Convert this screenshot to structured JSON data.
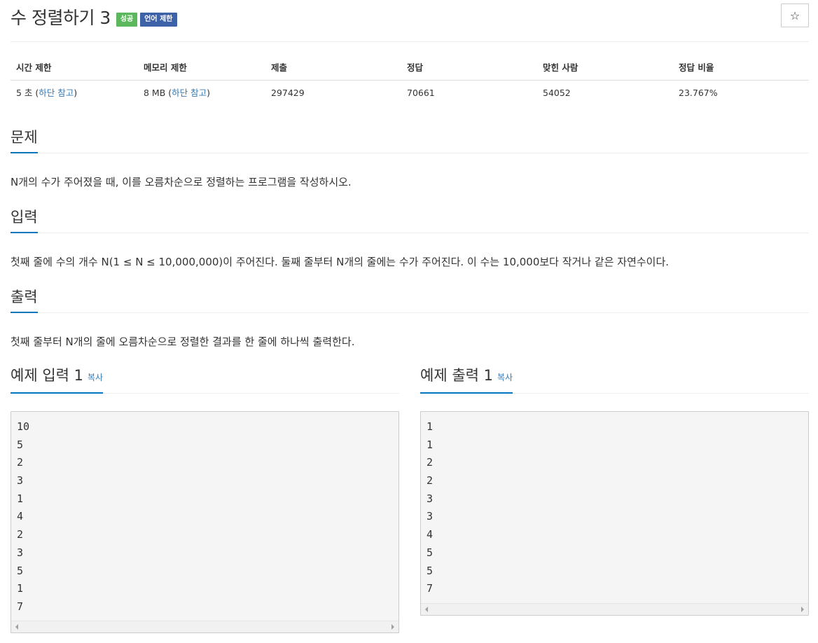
{
  "problem": {
    "title": "수 정렬하기 3",
    "badges": {
      "success": "성공",
      "language_limit": "언어 제한"
    },
    "star_icon": "☆"
  },
  "stats": {
    "headers": {
      "time_limit": "시간 제한",
      "memory_limit": "메모리 제한",
      "submissions": "제출",
      "accepted": "정답",
      "solved_users": "맞힌 사람",
      "accept_ratio": "정답 비율"
    },
    "values": {
      "time_value": "5 초 (",
      "time_link": "하단 참고",
      "time_close": ")",
      "memory_value": "8 MB (",
      "memory_link": "하단 참고",
      "memory_close": ")",
      "submissions": "297429",
      "accepted": "70661",
      "solved_users": "54052",
      "accept_ratio": "23.767%"
    }
  },
  "sections": {
    "description": {
      "title": "문제",
      "text": "N개의 수가 주어졌을 때, 이를 오름차순으로 정렬하는 프로그램을 작성하시오."
    },
    "input": {
      "title": "입력",
      "text": "첫째 줄에 수의 개수 N(1 ≤ N ≤ 10,000,000)이 주어진다. 둘째 줄부터 N개의 줄에는 수가 주어진다. 이 수는 10,000보다 작거나 같은 자연수이다."
    },
    "output": {
      "title": "출력",
      "text": "첫째 줄부터 N개의 줄에 오름차순으로 정렬한 결과를 한 줄에 하나씩 출력한다."
    }
  },
  "samples": {
    "input": {
      "title": "예제 입력 1",
      "copy": "복사",
      "lines": [
        "10",
        "5",
        "2",
        "3",
        "1",
        "4",
        "2",
        "3",
        "5",
        "1",
        "7"
      ]
    },
    "output": {
      "title": "예제 출력 1",
      "copy": "복사",
      "lines": [
        "1",
        "1",
        "2",
        "2",
        "3",
        "3",
        "4",
        "5",
        "5",
        "7"
      ]
    }
  },
  "colors": {
    "success_badge": "#5cb85c",
    "language_badge": "#3e62a8",
    "link": "#337ab7",
    "section_underline": "#0076c0"
  }
}
